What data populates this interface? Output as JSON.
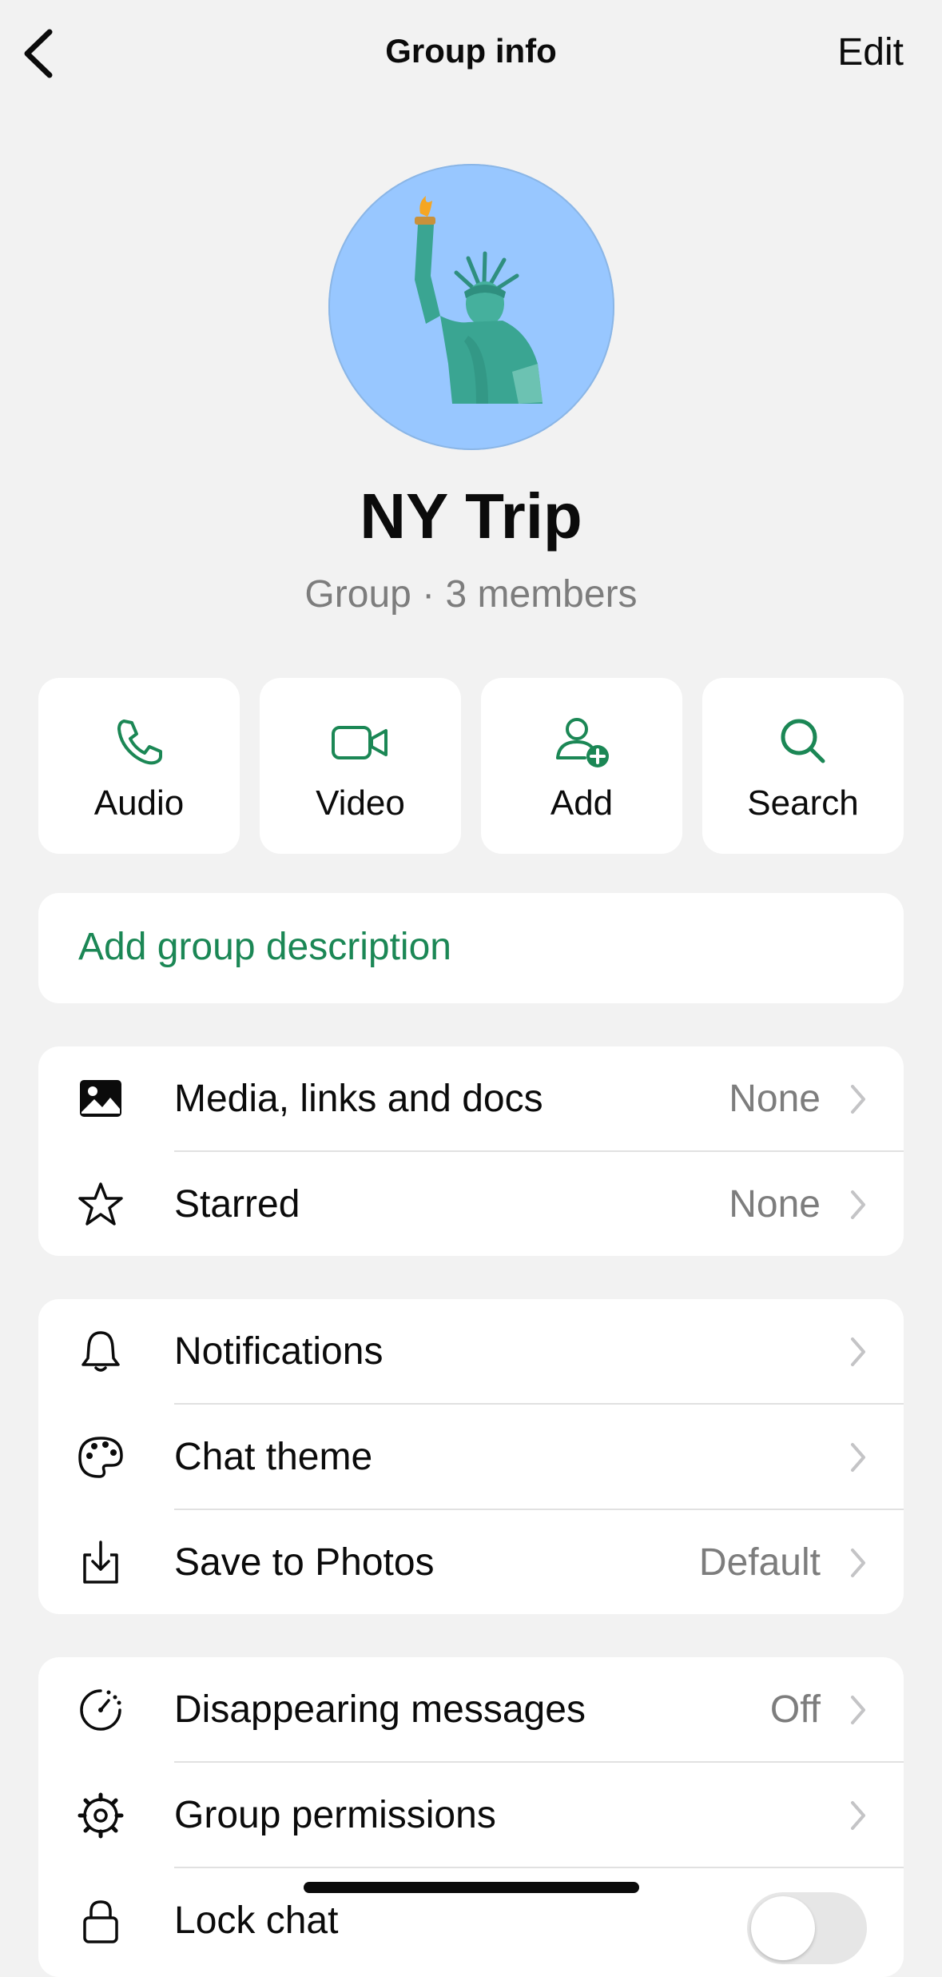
{
  "header": {
    "title": "Group info",
    "edit_label": "Edit",
    "back_icon": "chevron-left-icon"
  },
  "group": {
    "name": "NY Trip",
    "subtitle": "Group · 3 members",
    "avatar_icon": "statue-of-liberty-icon"
  },
  "actions": [
    {
      "label": "Audio",
      "icon": "phone-icon"
    },
    {
      "label": "Video",
      "icon": "video-camera-icon"
    },
    {
      "label": "Add",
      "icon": "add-person-icon"
    },
    {
      "label": "Search",
      "icon": "search-icon"
    }
  ],
  "description": {
    "placeholder": "Add group description"
  },
  "section_media": [
    {
      "label": "Media, links and docs",
      "value": "None",
      "icon": "image-icon"
    },
    {
      "label": "Starred",
      "value": "None",
      "icon": "star-icon"
    }
  ],
  "section_settings": [
    {
      "label": "Notifications",
      "value": "",
      "icon": "bell-icon"
    },
    {
      "label": "Chat theme",
      "value": "",
      "icon": "palette-icon"
    },
    {
      "label": "Save to Photos",
      "value": "Default",
      "icon": "download-icon"
    }
  ],
  "section_privacy": [
    {
      "label": "Disappearing messages",
      "value": "Off",
      "icon": "timer-icon"
    },
    {
      "label": "Group permissions",
      "value": "",
      "icon": "gear-icon"
    },
    {
      "label": "Lock chat",
      "value": "",
      "icon": "lock-icon",
      "toggle_on": false
    }
  ],
  "colors": {
    "accent": "#1b8755",
    "avatar_bg": "#98c7ff",
    "background": "#f2f2f2",
    "secondary_text": "#7d7d7d"
  }
}
